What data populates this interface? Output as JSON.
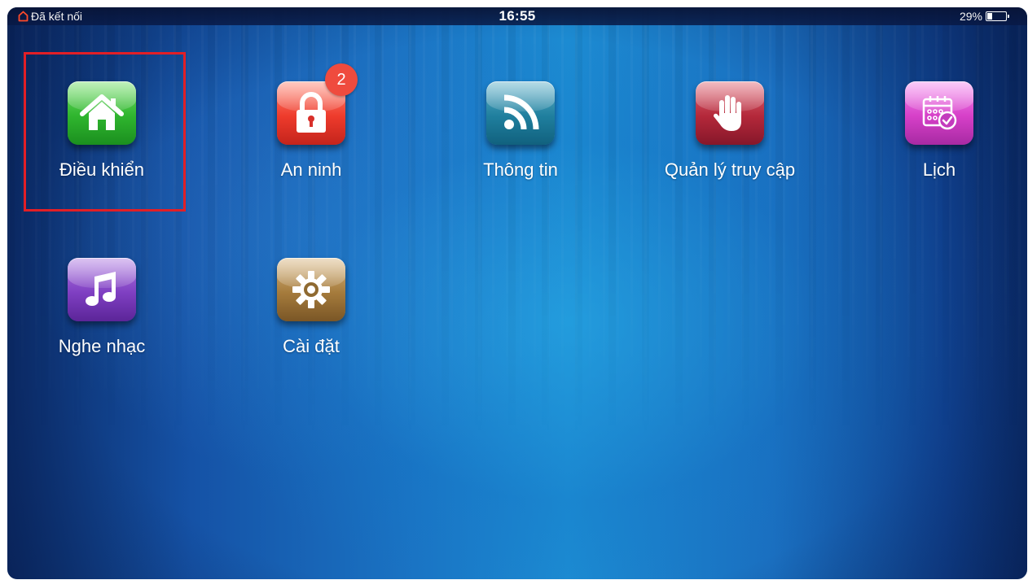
{
  "status_bar": {
    "connection": "Đã kết nối",
    "time": "16:55",
    "battery": "29%",
    "battery_level": 0.29
  },
  "apps": [
    {
      "label": "Điều khiển",
      "icon": "home-icon",
      "color": "#2fb52e"
    },
    {
      "label": "An ninh",
      "icon": "lock-icon",
      "color": "#ee3b2c",
      "badge": "2"
    },
    {
      "label": "Thông tin",
      "icon": "rss-icon",
      "color": "#1f7f9e"
    },
    {
      "label": "Quản lý truy cập",
      "icon": "hand-icon",
      "color": "#b4283a"
    },
    {
      "label": "Lịch",
      "icon": "calendar-icon",
      "color": "#d640c8"
    },
    {
      "label": "Nghe nhạc",
      "icon": "music-note-icon",
      "color": "#7f3fc2"
    },
    {
      "label": "Cài đặt",
      "icon": "gear-icon",
      "color": "#a57b3c"
    }
  ],
  "highlight_color": "#e21f26"
}
